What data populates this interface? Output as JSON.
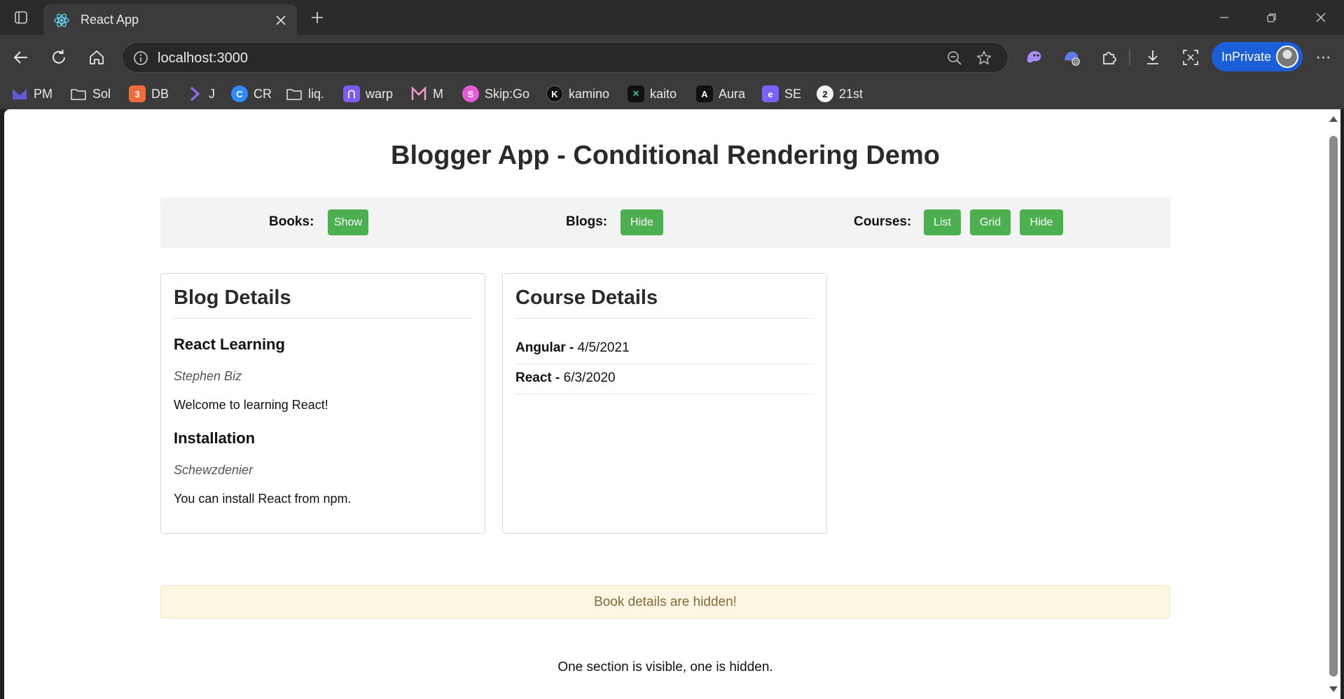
{
  "browser": {
    "tab": {
      "title": "React App"
    },
    "address_bar": {
      "url": "localhost:3000"
    },
    "profile": {
      "label": "InPrivate"
    },
    "bookmarks": [
      {
        "label": "PM",
        "icon": "m-logo-icon",
        "color": "#5b5bd6"
      },
      {
        "label": "Sol",
        "icon": "folder-icon",
        "color": ""
      },
      {
        "label": "DB",
        "icon": "db-logo-icon",
        "color": "#f26b3a"
      },
      {
        "label": "J",
        "icon": "chevron-logo-icon",
        "color": "#8e6cf0"
      },
      {
        "label": "CR",
        "icon": "cr-logo-icon",
        "color": "#2f8cff"
      },
      {
        "label": "liq.",
        "icon": "folder-icon",
        "color": ""
      },
      {
        "label": "warp",
        "icon": "warp-logo-icon",
        "color": "#7a5cf0"
      },
      {
        "label": "M",
        "icon": "m-outline-logo-icon",
        "color": "#f2a0c8"
      },
      {
        "label": "Skip:Go",
        "icon": "skip-logo-icon",
        "color": "#e85bd8"
      },
      {
        "label": "kamino",
        "icon": "kamino-logo-icon",
        "color": "#111111"
      },
      {
        "label": "kaito",
        "icon": "kaito-logo-icon",
        "color": "#111111"
      },
      {
        "label": "Aura",
        "icon": "aura-logo-icon",
        "color": "#111111"
      },
      {
        "label": "SE",
        "icon": "se-logo-icon",
        "color": "#7b61ff"
      },
      {
        "label": "21st",
        "icon": "21st-logo-icon",
        "color": "#111111"
      }
    ]
  },
  "page": {
    "title": "Blogger App - Conditional Rendering Demo",
    "controls": {
      "books": {
        "label": "Books:",
        "buttons": [
          "Show"
        ]
      },
      "blogs": {
        "label": "Blogs:",
        "buttons": [
          "Hide"
        ]
      },
      "courses": {
        "label": "Courses:",
        "buttons": [
          "List",
          "Grid",
          "Hide"
        ]
      }
    },
    "blog_card": {
      "title": "Blog Details",
      "posts": [
        {
          "title": "React Learning",
          "author": "Stephen Biz",
          "body": "Welcome to learning React!"
        },
        {
          "title": "Installation",
          "author": "Schewzdenier",
          "body": "You can install React from npm."
        }
      ]
    },
    "course_card": {
      "title": "Course Details",
      "courses": [
        {
          "name": "Angular",
          "separator": " - ",
          "date": "4/5/2021"
        },
        {
          "name": "React",
          "separator": " - ",
          "date": "6/3/2020"
        }
      ]
    },
    "alert": "Book details are hidden!",
    "footer_note": "One section is visible, one is hidden.",
    "colors": {
      "button_green": "#4caf50",
      "alert_bg": "#fdf6e3",
      "alert_text": "#856a3a",
      "inprivate_blue": "#1a5fd8"
    }
  }
}
